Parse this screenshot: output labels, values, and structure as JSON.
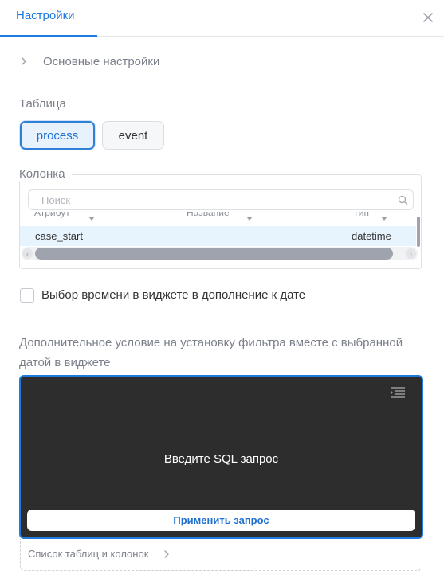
{
  "header": {
    "tab_label": "Настройки",
    "close_icon": "close-icon"
  },
  "basic_settings": {
    "label": "Основные настройки",
    "expanded": false
  },
  "table_section": {
    "label": "Таблица",
    "options": [
      "process",
      "event"
    ],
    "selected": "process"
  },
  "column_section": {
    "label": "Колонка",
    "search_placeholder": "Поиск",
    "columns": [
      "Атрибут",
      "Название",
      "Тип"
    ],
    "rows": [
      {
        "attribute": "case_start",
        "name": "",
        "type": "datetime"
      }
    ]
  },
  "time_option": {
    "label": "Выбор времени в виджете в дополнение к дате",
    "checked": false
  },
  "condition": {
    "label": "Дополнительное условие на установку фильтра вместе с выбранной датой в виджете",
    "editor_placeholder": "Введите SQL запрос",
    "apply_label": "Применить запрос",
    "format_icon": "format-indent-icon"
  },
  "tables_list": {
    "label": "Список таблиц и колонок"
  },
  "colors": {
    "accent": "#1f7ae0",
    "editor_bg": "#2d2d2d",
    "selected_row": "#e8f4fd"
  }
}
